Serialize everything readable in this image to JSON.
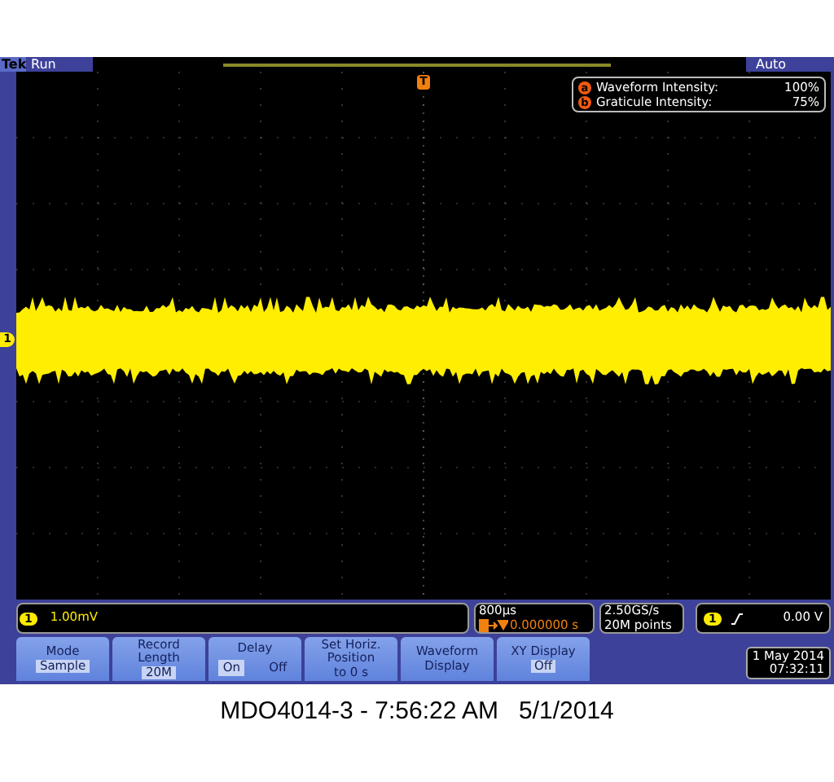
{
  "status": {
    "logo": "Tek",
    "run_state": "Run",
    "trigger_mode": "Auto"
  },
  "trigger_marker": "T",
  "channel_marker": "1",
  "intensity": [
    {
      "marker": "a",
      "label": "Waveform Intensity:",
      "value": "100%"
    },
    {
      "marker": "b",
      "label": "Graticule Intensity:",
      "value": "75%"
    }
  ],
  "readouts": {
    "channel": {
      "marker": "1",
      "scale": "1.00mV"
    },
    "timebase": {
      "scale": "800µs",
      "position": "0.000000 s"
    },
    "acquisition": {
      "rate": "2.50GS/s",
      "points": "20M points"
    },
    "trigger": {
      "marker": "1",
      "level": "0.00 V"
    }
  },
  "buttons": [
    {
      "kind": "value",
      "lines": [
        "Mode"
      ],
      "value": "Sample"
    },
    {
      "kind": "value",
      "lines": [
        "Record",
        "Length"
      ],
      "value": "20M"
    },
    {
      "kind": "toggle",
      "lines": [
        "Delay"
      ],
      "options": [
        {
          "label": "On",
          "selected": true
        },
        {
          "label": "Off",
          "selected": false
        }
      ]
    },
    {
      "kind": "plain",
      "lines": [
        "Set Horiz.",
        "Position",
        "to 0 s"
      ]
    },
    {
      "kind": "plain",
      "lines": [
        "Waveform",
        "Display"
      ]
    },
    {
      "kind": "value",
      "lines": [
        "XY Display"
      ],
      "value": "Off"
    }
  ],
  "clock": {
    "date": "1 May 2014",
    "time": "07:32:11"
  },
  "caption": "MDO4014-3 - 7:56:22 AM   5/1/2014"
}
